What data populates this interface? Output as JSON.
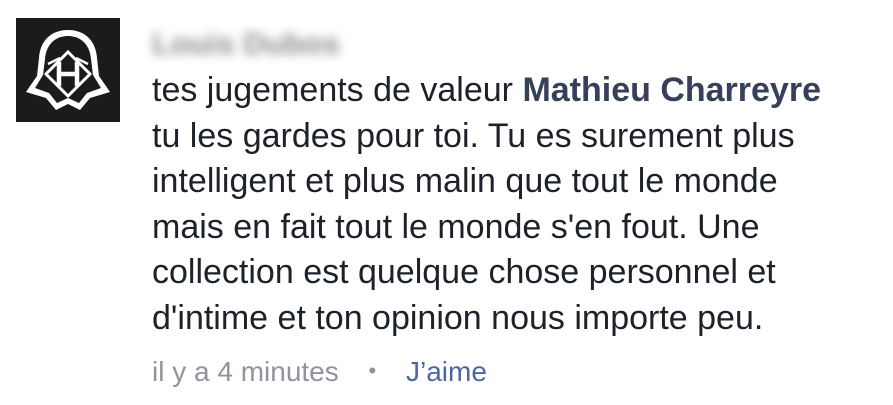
{
  "author": {
    "name": "Louis Dubos"
  },
  "comment": {
    "line1_prefix": "tes jugements de valeur ",
    "mention": "Mathieu Charreyre",
    "lines": [
      "tu les gardes pour toi. Tu es surement plus",
      "intelligent et plus malin que tout le monde",
      "mais en fait tout le monde s'en fout. Une",
      "collection est quelque chose personnel et",
      "d'intime et ton opinion nous importe peu."
    ]
  },
  "meta": {
    "timestamp": "il y a 4 minutes",
    "separator": "•",
    "like_label": "J’aime"
  },
  "colors": {
    "text": "#1d2129",
    "mention": "#36405a",
    "meta": "#90949c",
    "like": "#4b66a0",
    "avatar_bg": "#1b1b1b"
  },
  "icons": {
    "avatar": "darth-vader-helmet-h-logo"
  }
}
